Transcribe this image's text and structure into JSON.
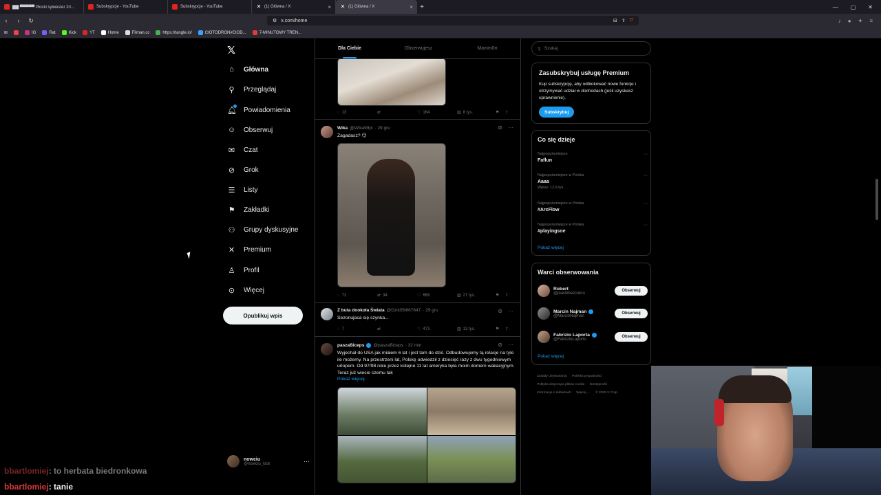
{
  "browser": {
    "tabs": [
      {
        "title": "▇▇ ▀▀▀▀▀ Płocki sylwester 20...",
        "icon": "youtube-icon"
      },
      {
        "title": "Subskrypcje - YouTube",
        "icon": "youtube-icon"
      },
      {
        "title": "Subskrypcje - YouTube",
        "icon": "youtube-icon"
      },
      {
        "title": "(1) Główna / X",
        "icon": "x-icon"
      },
      {
        "title": "(1) Główna / X",
        "icon": "x-icon",
        "active": true
      }
    ],
    "url": "x.com/home",
    "bookmarks": [
      "IG",
      "Rat",
      "Kick",
      "YT",
      "Home",
      "Filman.cc",
      "https://tangle.io/",
      "CIOTODRON#CIOD...",
      "7-MINUTOWY TREN..."
    ]
  },
  "nav": {
    "items": [
      {
        "label": "Główna",
        "icon": "home-icon",
        "glyph": "⌂"
      },
      {
        "label": "Przeglądaj",
        "icon": "search-icon",
        "glyph": "⚲"
      },
      {
        "label": "Powiadomienia",
        "icon": "bell-icon",
        "glyph": "♫"
      },
      {
        "label": "Obserwuj",
        "icon": "follow-icon",
        "glyph": "☺"
      },
      {
        "label": "Czat",
        "icon": "mail-icon",
        "glyph": "✉"
      },
      {
        "label": "Grok",
        "icon": "grok-icon",
        "glyph": "⊘"
      },
      {
        "label": "Listy",
        "icon": "list-icon",
        "glyph": "☰"
      },
      {
        "label": "Zakładki",
        "icon": "bookmark-icon",
        "glyph": "⚑"
      },
      {
        "label": "Grupy dyskusyjne",
        "icon": "communities-icon",
        "glyph": "⚇"
      },
      {
        "label": "Premium",
        "icon": "x-premium-icon",
        "glyph": "✕"
      },
      {
        "label": "Profil",
        "icon": "profile-icon",
        "glyph": "♙"
      },
      {
        "label": "Więcej",
        "icon": "more-circle-icon",
        "glyph": "⊙"
      }
    ],
    "post_button": "Opublikuj wpis",
    "account": {
      "name": "nowciu",
      "handle": "@nowciu_kick"
    }
  },
  "timeline": {
    "tabs": [
      "Dla Ciebie",
      "Obserwujesz",
      "Mamm0n"
    ],
    "tweets": [
      {
        "actions": {
          "replies": "13",
          "retweets": "",
          "likes": "164",
          "views": "8 tys."
        }
      },
      {
        "name": "Wika",
        "handle": "@Wika99pl",
        "time": "· 29 gru",
        "text": "Zagadasz? 😏",
        "actions": {
          "replies": "72",
          "retweets": "34",
          "likes": "669",
          "views": "27 tys."
        }
      },
      {
        "name": "Z buta dookoła Świata",
        "handle": "@Dziki59667847",
        "time": "· 29 gru",
        "text": "Sezonujaca się szynka...",
        "actions": {
          "replies": "7",
          "retweets": "",
          "likes": "473",
          "views": "13 tys."
        }
      },
      {
        "name": "paszaBiceps",
        "handle": "@paszaBiceps",
        "time": "· 32 min",
        "text": "Wyjechał do USA jak miałem 6 lat i jest tam do dziś. Odbudowujemy tą relacje na tyle ile możemy. Na przestrzeni lat, Polskę odwiedził z dziesięć razy z dwu tygodniowym urlopem. Od 97/98 roku przez kolejne 11 lat ameryka była moim domem wakacyjnym. Teraz już wiecie czemu tak",
        "show_more": "Pokaż więcej"
      }
    ]
  },
  "sidebar": {
    "search_placeholder": "Szukaj",
    "premium": {
      "title": "Zasubskrybuj usługę Premium",
      "text": "Kup subskrypcję, aby odblokować nowe funkcje i otrzymywać udział w dochodach (jeśli uzyskasz uprawnienie).",
      "button": "Subskrybuj"
    },
    "trends": {
      "title": "Co się dzieje",
      "items": [
        {
          "context": "Najpopularniejsze",
          "name": "Faflun",
          "count": ""
        },
        {
          "context": "Najpopularniejsze w Polska",
          "name": "Aaaa",
          "count": "Wpisy: 12,9 tys."
        },
        {
          "context": "Najpopularniejsze w Polska",
          "name": "#ArcFlow",
          "count": ""
        },
        {
          "context": "Najpopularniejsze w Polska",
          "name": "#playingsoe",
          "count": ""
        }
      ],
      "show_more": "Pokaż więcej"
    },
    "who_to_follow": {
      "title": "Warci obserwowania",
      "items": [
        {
          "name": "Robert",
          "handle": "@piackibezcukru",
          "verified": false,
          "button": "Obserwuj"
        },
        {
          "name": "Marcin Najman",
          "handle": "@MarcinNajman",
          "verified": true,
          "button": "Obserwuj"
        },
        {
          "name": "Fabrizio Laporta",
          "handle": "@FabrizioLaporto",
          "verified": true,
          "button": "Obserwuj"
        }
      ],
      "show_more": "Pokaż więcej"
    },
    "footer": [
      "Zasady użytkowania",
      "Polityka prywatności",
      "Polityka dotycząca plików cookie",
      "Dostępność",
      "Informacje o reklamach",
      "Więcej ···",
      "© 2025 X Corp."
    ]
  },
  "chat": [
    {
      "user": "bbartlomiej",
      "message": ": to herbata biedronkowa"
    },
    {
      "user": "bbartlomiej",
      "message": ": tanie"
    }
  ]
}
